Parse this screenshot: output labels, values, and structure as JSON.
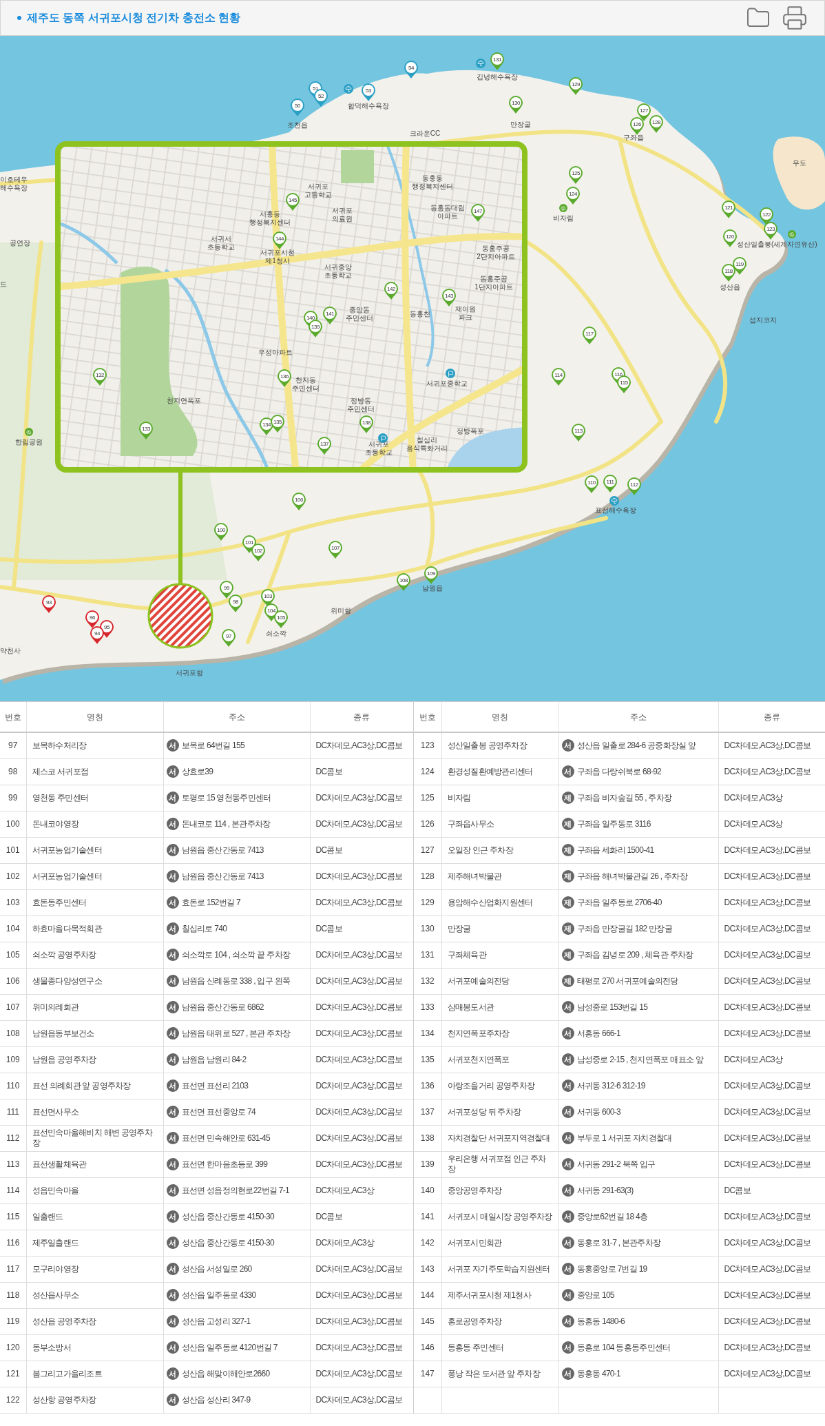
{
  "header": {
    "title": "제주도 동쪽 서귀포시청 전기차 충전소 현황"
  },
  "map": {
    "pins": [
      {
        "label": "131",
        "color": "#5aaa2d"
      },
      {
        "label": "54",
        "color": "#2a9fc4"
      },
      {
        "label": "53",
        "color": "#2a9fc4"
      },
      {
        "label": "51",
        "color": "#2a9fc4"
      },
      {
        "label": "52",
        "color": "#2a9fc4"
      },
      {
        "label": "50",
        "color": "#2a9fc4"
      },
      {
        "label": "129",
        "color": "#5aaa2d"
      },
      {
        "label": "130",
        "color": "#5aaa2d"
      },
      {
        "label": "127",
        "color": "#5aaa2d"
      },
      {
        "label": "126",
        "color": "#5aaa2d"
      },
      {
        "label": "128",
        "color": "#5aaa2d"
      },
      {
        "label": "125",
        "color": "#5aaa2d"
      },
      {
        "label": "124",
        "color": "#5aaa2d"
      },
      {
        "label": "145",
        "color": "#5aaa2d"
      },
      {
        "label": "147",
        "color": "#5aaa2d"
      },
      {
        "label": "144",
        "color": "#5aaa2d"
      },
      {
        "label": "121",
        "color": "#5aaa2d"
      },
      {
        "label": "122",
        "color": "#5aaa2d"
      },
      {
        "label": "123",
        "color": "#5aaa2d"
      },
      {
        "label": "120",
        "color": "#5aaa2d"
      },
      {
        "label": "119",
        "color": "#5aaa2d"
      },
      {
        "label": "118",
        "color": "#5aaa2d"
      },
      {
        "label": "142",
        "color": "#5aaa2d"
      },
      {
        "label": "143",
        "color": "#5aaa2d"
      },
      {
        "label": "141",
        "color": "#5aaa2d"
      },
      {
        "label": "140",
        "color": "#5aaa2d"
      },
      {
        "label": "139",
        "color": "#5aaa2d"
      },
      {
        "label": "117",
        "color": "#5aaa2d"
      },
      {
        "label": "132",
        "color": "#5aaa2d"
      },
      {
        "label": "136",
        "color": "#5aaa2d"
      },
      {
        "label": "114",
        "color": "#5aaa2d"
      },
      {
        "label": "116",
        "color": "#5aaa2d"
      },
      {
        "label": "115",
        "color": "#5aaa2d"
      },
      {
        "label": "133",
        "color": "#5aaa2d"
      },
      {
        "label": "134",
        "color": "#5aaa2d"
      },
      {
        "label": "135",
        "color": "#5aaa2d"
      },
      {
        "label": "138",
        "color": "#5aaa2d"
      },
      {
        "label": "137",
        "color": "#5aaa2d"
      },
      {
        "label": "113",
        "color": "#5aaa2d"
      },
      {
        "label": "110",
        "color": "#5aaa2d"
      },
      {
        "label": "111",
        "color": "#5aaa2d"
      },
      {
        "label": "112",
        "color": "#5aaa2d"
      },
      {
        "label": "106",
        "color": "#5aaa2d"
      },
      {
        "label": "100",
        "color": "#5aaa2d"
      },
      {
        "label": "101",
        "color": "#5aaa2d"
      },
      {
        "label": "102",
        "color": "#5aaa2d"
      },
      {
        "label": "107",
        "color": "#5aaa2d"
      },
      {
        "label": "108",
        "color": "#5aaa2d"
      },
      {
        "label": "109",
        "color": "#5aaa2d"
      },
      {
        "label": "99",
        "color": "#5aaa2d"
      },
      {
        "label": "98",
        "color": "#5aaa2d"
      },
      {
        "label": "103",
        "color": "#5aaa2d"
      },
      {
        "label": "104",
        "color": "#5aaa2d"
      },
      {
        "label": "105",
        "color": "#5aaa2d"
      },
      {
        "label": "97",
        "color": "#5aaa2d"
      },
      {
        "label": "93",
        "color": "#d7262c"
      },
      {
        "label": "96",
        "color": "#d7262c"
      },
      {
        "label": "95",
        "color": "#d7262c"
      },
      {
        "label": "94",
        "color": "#d7262c"
      }
    ],
    "places": [
      {
        "name": "김녕해수욕장"
      },
      {
        "name": "함덕해수욕장"
      },
      {
        "name": "조천읍"
      },
      {
        "name": "만장굴"
      },
      {
        "name": "크라운CC"
      },
      {
        "name": "구좌읍"
      },
      {
        "name": "우도"
      },
      {
        "name": "이호테우\n해수욕장"
      },
      {
        "name": "비자림"
      },
      {
        "name": "공연장"
      },
      {
        "name": "성산일출봉(세계자연유산)"
      },
      {
        "name": "드"
      },
      {
        "name": "성산읍"
      },
      {
        "name": "섭지코지"
      },
      {
        "name": "동홍동\n행정복지센터"
      },
      {
        "name": "서귀포\n고등학교"
      },
      {
        "name": "서귀포\n의료원"
      },
      {
        "name": "서홍동\n행정복지센터"
      },
      {
        "name": "동홍동대림\n아파트"
      },
      {
        "name": "서귀서\n초등학교"
      },
      {
        "name": "서귀포시청\n제1청사"
      },
      {
        "name": "동홍주공\n2단지아파트"
      },
      {
        "name": "서귀중앙\n초등학교"
      },
      {
        "name": "동홍주공\n1단지아파트"
      },
      {
        "name": "중앙동\n주민센터"
      },
      {
        "name": "동홍천"
      },
      {
        "name": "제이원\n파크"
      },
      {
        "name": "우성아파트"
      },
      {
        "name": "천지동\n주민센터"
      },
      {
        "name": "서귀포중학교"
      },
      {
        "name": "천지연폭포"
      },
      {
        "name": "정방동\n주민센터"
      },
      {
        "name": "정방폭포"
      },
      {
        "name": "한림공원"
      },
      {
        "name": "서귀포\n초등학교"
      },
      {
        "name": "칠십리\n음식특화거리"
      },
      {
        "name": "표선해수욕장"
      },
      {
        "name": "남원읍"
      },
      {
        "name": "위미항"
      },
      {
        "name": "쇠소깍"
      },
      {
        "name": "약천사"
      },
      {
        "name": "서귀포항"
      }
    ]
  },
  "tables": [
    {
      "columns": [
        "번호",
        "명칭",
        "주소",
        "종류"
      ],
      "rows": [
        {
          "number": "97",
          "name": "보목하수처리장",
          "district": "서",
          "address": "보목로 64번길 155",
          "charger_types": "DC차데모,AC3상,DC콤보"
        },
        {
          "number": "98",
          "name": "제스코 서귀포점",
          "district": "서",
          "address": "상효로39",
          "charger_types": "DC콤보"
        },
        {
          "number": "99",
          "name": "영천동 주민센터",
          "district": "서",
          "address": "토평로 15 영천동주민센터",
          "charger_types": "DC차데모,AC3상,DC콤보"
        },
        {
          "number": "100",
          "name": "돈내코야영장",
          "district": "서",
          "address": "돈내코로 114 , 본관주차장",
          "charger_types": "DC차데모,AC3상,DC콤보"
        },
        {
          "number": "101",
          "name": "서귀포농업기술센터",
          "district": "서",
          "address": "남원읍 중산간동로 7413",
          "charger_types": "DC콤보"
        },
        {
          "number": "102",
          "name": "서귀포농업기술센터",
          "district": "서",
          "address": "남원읍 중산간동로 7413",
          "charger_types": "DC차데모,AC3상,DC콤보"
        },
        {
          "number": "103",
          "name": "효돈동주민센터",
          "district": "서",
          "address": "효돈로 152번길 7",
          "charger_types": "DC차데모,AC3상,DC콤보"
        },
        {
          "number": "104",
          "name": "하효마을다목적회관",
          "district": "서",
          "address": "칠십리로 740",
          "charger_types": "DC콤보"
        },
        {
          "number": "105",
          "name": "쇠소깍 공영주차장",
          "district": "서",
          "address": "쇠소깍로 104 , 쇠소깍 끝 주차장",
          "charger_types": "DC차데모,AC3상,DC콤보"
        },
        {
          "number": "106",
          "name": "생물종다양성연구소",
          "district": "서",
          "address": "남원읍 신례동로 338 , 입구 왼쪽",
          "charger_types": "DC차데모,AC3상,DC콤보"
        },
        {
          "number": "107",
          "name": "위미의례회관",
          "district": "서",
          "address": "남원읍 중산간동로 6862",
          "charger_types": "DC차데모,AC3상,DC콤보"
        },
        {
          "number": "108",
          "name": "남원읍동부보건소",
          "district": "서",
          "address": "남원읍 태위로 527 , 본관 주차장",
          "charger_types": "DC차데모,AC3상,DC콤보"
        },
        {
          "number": "109",
          "name": "남원읍 공영주차장",
          "district": "서",
          "address": "남원읍 남원리 84-2",
          "charger_types": "DC차데모,AC3상,DC콤보"
        },
        {
          "number": "110",
          "name": "표선 의례회관 앞 공영주차장",
          "district": "서",
          "address": "표선면 표선리 2103",
          "charger_types": "DC차데모,AC3상,DC콤보"
        },
        {
          "number": "111",
          "name": "표선면사무소",
          "district": "서",
          "address": "표선면 표선중앙로 74",
          "charger_types": "DC차데모,AC3상,DC콤보"
        },
        {
          "number": "112",
          "name": "표선민속마을해비치 해변 공영주차장",
          "district": "서",
          "address": "표선면 민속해안로 631-45",
          "charger_types": "DC차데모,AC3상,DC콤보"
        },
        {
          "number": "113",
          "name": "표선생활체육관",
          "district": "서",
          "address": "표선면 한마음초등로 399",
          "charger_types": "DC차데모,AC3상,DC콤보"
        },
        {
          "number": "114",
          "name": "성읍민속마을",
          "district": "서",
          "address": "표선면 성읍정의현로22번길 7-1",
          "charger_types": "DC차데모,AC3상"
        },
        {
          "number": "115",
          "name": "일출랜드",
          "district": "서",
          "address": "성산읍 중산간동로 4150-30",
          "charger_types": "DC콤보"
        },
        {
          "number": "116",
          "name": "제주일출랜드",
          "district": "서",
          "address": "성산읍 중산간동로 4150-30",
          "charger_types": "DC차데모,AC3상"
        },
        {
          "number": "117",
          "name": "모구리야영장",
          "district": "서",
          "address": "성산읍 서성일로 260",
          "charger_types": "DC차데모,AC3상,DC콤보"
        },
        {
          "number": "118",
          "name": "성산읍사무소",
          "district": "서",
          "address": "성산읍 일주동로 4330",
          "charger_types": "DC차데모,AC3상,DC콤보"
        },
        {
          "number": "119",
          "name": "성산읍 공영주차장",
          "district": "서",
          "address": "성산읍 고성리 327-1",
          "charger_types": "DC차데모,AC3상,DC콤보"
        },
        {
          "number": "120",
          "name": "동부소방서",
          "district": "서",
          "address": "성산읍 일주동로 4120번길 7",
          "charger_types": "DC차데모,AC3상,DC콤보"
        },
        {
          "number": "121",
          "name": "봄그리고가을리조트",
          "district": "서",
          "address": "성산읍 해맞이해안로2660",
          "charger_types": "DC차데모,AC3상,DC콤보"
        },
        {
          "number": "122",
          "name": "성산항 공영주차장",
          "district": "서",
          "address": "성산읍 성산리 347-9",
          "charger_types": "DC차데모,AC3상,DC콤보"
        }
      ]
    },
    {
      "columns": [
        "번호",
        "명칭",
        "주소",
        "종류"
      ],
      "rows": [
        {
          "number": "123",
          "name": "성산일출봉 공영주차장",
          "district": "서",
          "address": "성산읍 일출로 284-6 공중화장실 앞",
          "charger_types": "DC차데모,AC3상,DC콤보"
        },
        {
          "number": "124",
          "name": "환경성질환예방관리센터",
          "district": "서",
          "address": "구좌읍 다랑쉬북로 68-92",
          "charger_types": "DC차데모,AC3상,DC콤보"
        },
        {
          "number": "125",
          "name": "비자림",
          "district": "제",
          "address": "구좌읍 비자숲길 55 , 주차장",
          "charger_types": "DC차데모,AC3상"
        },
        {
          "number": "126",
          "name": "구좌읍사무소",
          "district": "제",
          "address": "구좌읍 일주동로 3116",
          "charger_types": "DC차데모,AC3상"
        },
        {
          "number": "127",
          "name": "오일장 인근 주차장",
          "district": "제",
          "address": "구좌읍 세화리 1500-41",
          "charger_types": "DC차데모,AC3상,DC콤보"
        },
        {
          "number": "128",
          "name": "제주해녀박물관",
          "district": "제",
          "address": "구좌읍 해녀박물관길 26 , 주차장",
          "charger_types": "DC차데모,AC3상,DC콤보"
        },
        {
          "number": "129",
          "name": "용암해수산업화지원센터",
          "district": "제",
          "address": "구좌읍 일주동로 2706-40",
          "charger_types": "DC차데모,AC3상,DC콤보"
        },
        {
          "number": "130",
          "name": "만장굴",
          "district": "제",
          "address": "구좌읍 만장굴길 182 만장굴",
          "charger_types": "DC차데모,AC3상,DC콤보"
        },
        {
          "number": "131",
          "name": "구좌체육관",
          "district": "제",
          "address": "구좌읍 김녕로 209 , 체육관 주차장",
          "charger_types": "DC차데모,AC3상,DC콤보"
        },
        {
          "number": "132",
          "name": "서귀포예술의전당",
          "district": "제",
          "address": "태평로 270 서귀포예술의전당",
          "charger_types": "DC차데모,AC3상,DC콤보"
        },
        {
          "number": "133",
          "name": "삼매봉도서관",
          "district": "서",
          "address": "남성중로 153번길 15",
          "charger_types": "DC차데모,AC3상,DC콤보"
        },
        {
          "number": "134",
          "name": "천지연폭포주차장",
          "district": "서",
          "address": "서홍동 666-1",
          "charger_types": "DC차데모,AC3상,DC콤보"
        },
        {
          "number": "135",
          "name": "서귀포천지연폭포",
          "district": "서",
          "address": "남성중로 2-15 , 천지연폭포 매표소 앞",
          "charger_types": "DC차데모,AC3상"
        },
        {
          "number": "136",
          "name": "아랑조을거리 공영주차장",
          "district": "서",
          "address": "서귀동 312-6 312-19",
          "charger_types": "DC차데모,AC3상,DC콤보"
        },
        {
          "number": "137",
          "name": "서귀포성당 뒤 주차장",
          "district": "서",
          "address": "서귀동 600-3",
          "charger_types": "DC차데모,AC3상,DC콤보"
        },
        {
          "number": "138",
          "name": "자치경찰단 서귀포지역경찰대",
          "district": "서",
          "address": "부두로 1 서귀포 자치경찰대",
          "charger_types": "DC차데모,AC3상,DC콤보"
        },
        {
          "number": "139",
          "name": "우리은행 서귀포점 인근 주차장",
          "district": "서",
          "address": "서귀동 291-2 북쪽 입구",
          "charger_types": "DC차데모,AC3상,DC콤보"
        },
        {
          "number": "140",
          "name": "중앙공영주차장",
          "district": "서",
          "address": "서귀동 291-63(3)",
          "charger_types": "DC콤보"
        },
        {
          "number": "141",
          "name": "서귀포시 매일시장 공영주차장",
          "district": "서",
          "address": "중앙로62번길 18 4층",
          "charger_types": "DC차데모,AC3상,DC콤보"
        },
        {
          "number": "142",
          "name": "서귀포시민회관",
          "district": "서",
          "address": "동홍로 31-7 , 본관주차장",
          "charger_types": "DC차데모,AC3상,DC콤보"
        },
        {
          "number": "143",
          "name": "서귀포 자기주도학습지원센터",
          "district": "서",
          "address": "동홍중앙로 7번길 19",
          "charger_types": "DC차데모,AC3상,DC콤보"
        },
        {
          "number": "144",
          "name": "제주서귀포시청 제1청사",
          "district": "서",
          "address": "중앙로 105",
          "charger_types": "DC차데모,AC3상,DC콤보"
        },
        {
          "number": "145",
          "name": "홍로공영주차장",
          "district": "서",
          "address": "동홍동 1480-6",
          "charger_types": "DC차데모,AC3상,DC콤보"
        },
        {
          "number": "146",
          "name": "동홍동 주민센터",
          "district": "서",
          "address": "동홍로 104 동홍동주민센터",
          "charger_types": "DC차데모,AC3상,DC콤보"
        },
        {
          "number": "147",
          "name": "퐁낭 작은 도서관 앞 주차장",
          "district": "서",
          "address": "동홍동 470-1",
          "charger_types": "DC차데모,AC3상,DC콤보"
        }
      ]
    }
  ]
}
